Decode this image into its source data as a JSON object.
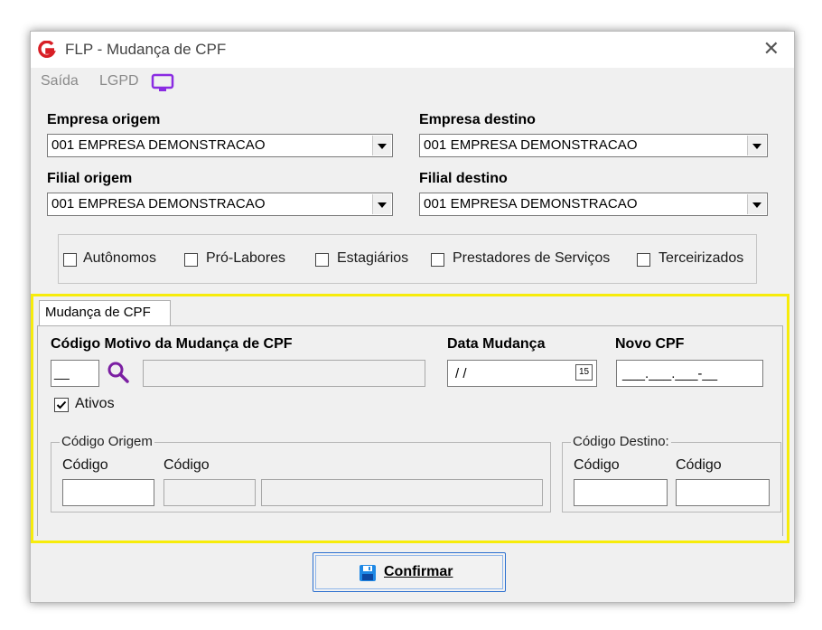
{
  "window": {
    "title": "FLP - Mudança de CPF",
    "close_glyph": "✕"
  },
  "menu": {
    "items": [
      "Saída",
      "LGPD"
    ],
    "lgpd_icon": "monitor-icon",
    "lgpd_icon_color": "#8a2be2"
  },
  "empresa_origem": {
    "label": "Empresa origem",
    "value": "001 EMPRESA DEMONSTRACAO"
  },
  "empresa_destino": {
    "label": "Empresa destino",
    "value": "001 EMPRESA DEMONSTRACAO"
  },
  "filial_origem": {
    "label": "Filial origem",
    "value": "001 EMPRESA DEMONSTRACAO"
  },
  "filial_destino": {
    "label": "Filial destino",
    "value": "001 EMPRESA DEMONSTRACAO"
  },
  "categorias": [
    {
      "label": "Autônomos",
      "checked": false
    },
    {
      "label": "Pró-Labores",
      "checked": false
    },
    {
      "label": "Estagiários",
      "checked": false
    },
    {
      "label": "Prestadores de Serviços",
      "checked": false
    },
    {
      "label": "Terceirizados",
      "checked": false
    }
  ],
  "tab": {
    "label": "Mudança de CPF",
    "highlight_color": "#f7ec0b"
  },
  "motivo": {
    "label": "Código Motivo da Mudança de CPF",
    "code_value": "__",
    "description_value": ""
  },
  "data_mudanca": {
    "label": "Data Mudança",
    "value": " / /",
    "calendar_icon_text": "15"
  },
  "novo_cpf": {
    "label": "Novo CPF",
    "value": "___.___.___-__"
  },
  "ativos": {
    "label": "Ativos",
    "checked": true
  },
  "codigo_origem": {
    "title": "Código Origem",
    "col1_label": "Código",
    "col2_label": "Código"
  },
  "codigo_destino": {
    "title": "Código Destino:",
    "col1_label": "Código",
    "col2_label": "Código"
  },
  "confirm": {
    "label": "Confirmar",
    "icon": "save-icon",
    "accent": "#2b6fcf"
  }
}
